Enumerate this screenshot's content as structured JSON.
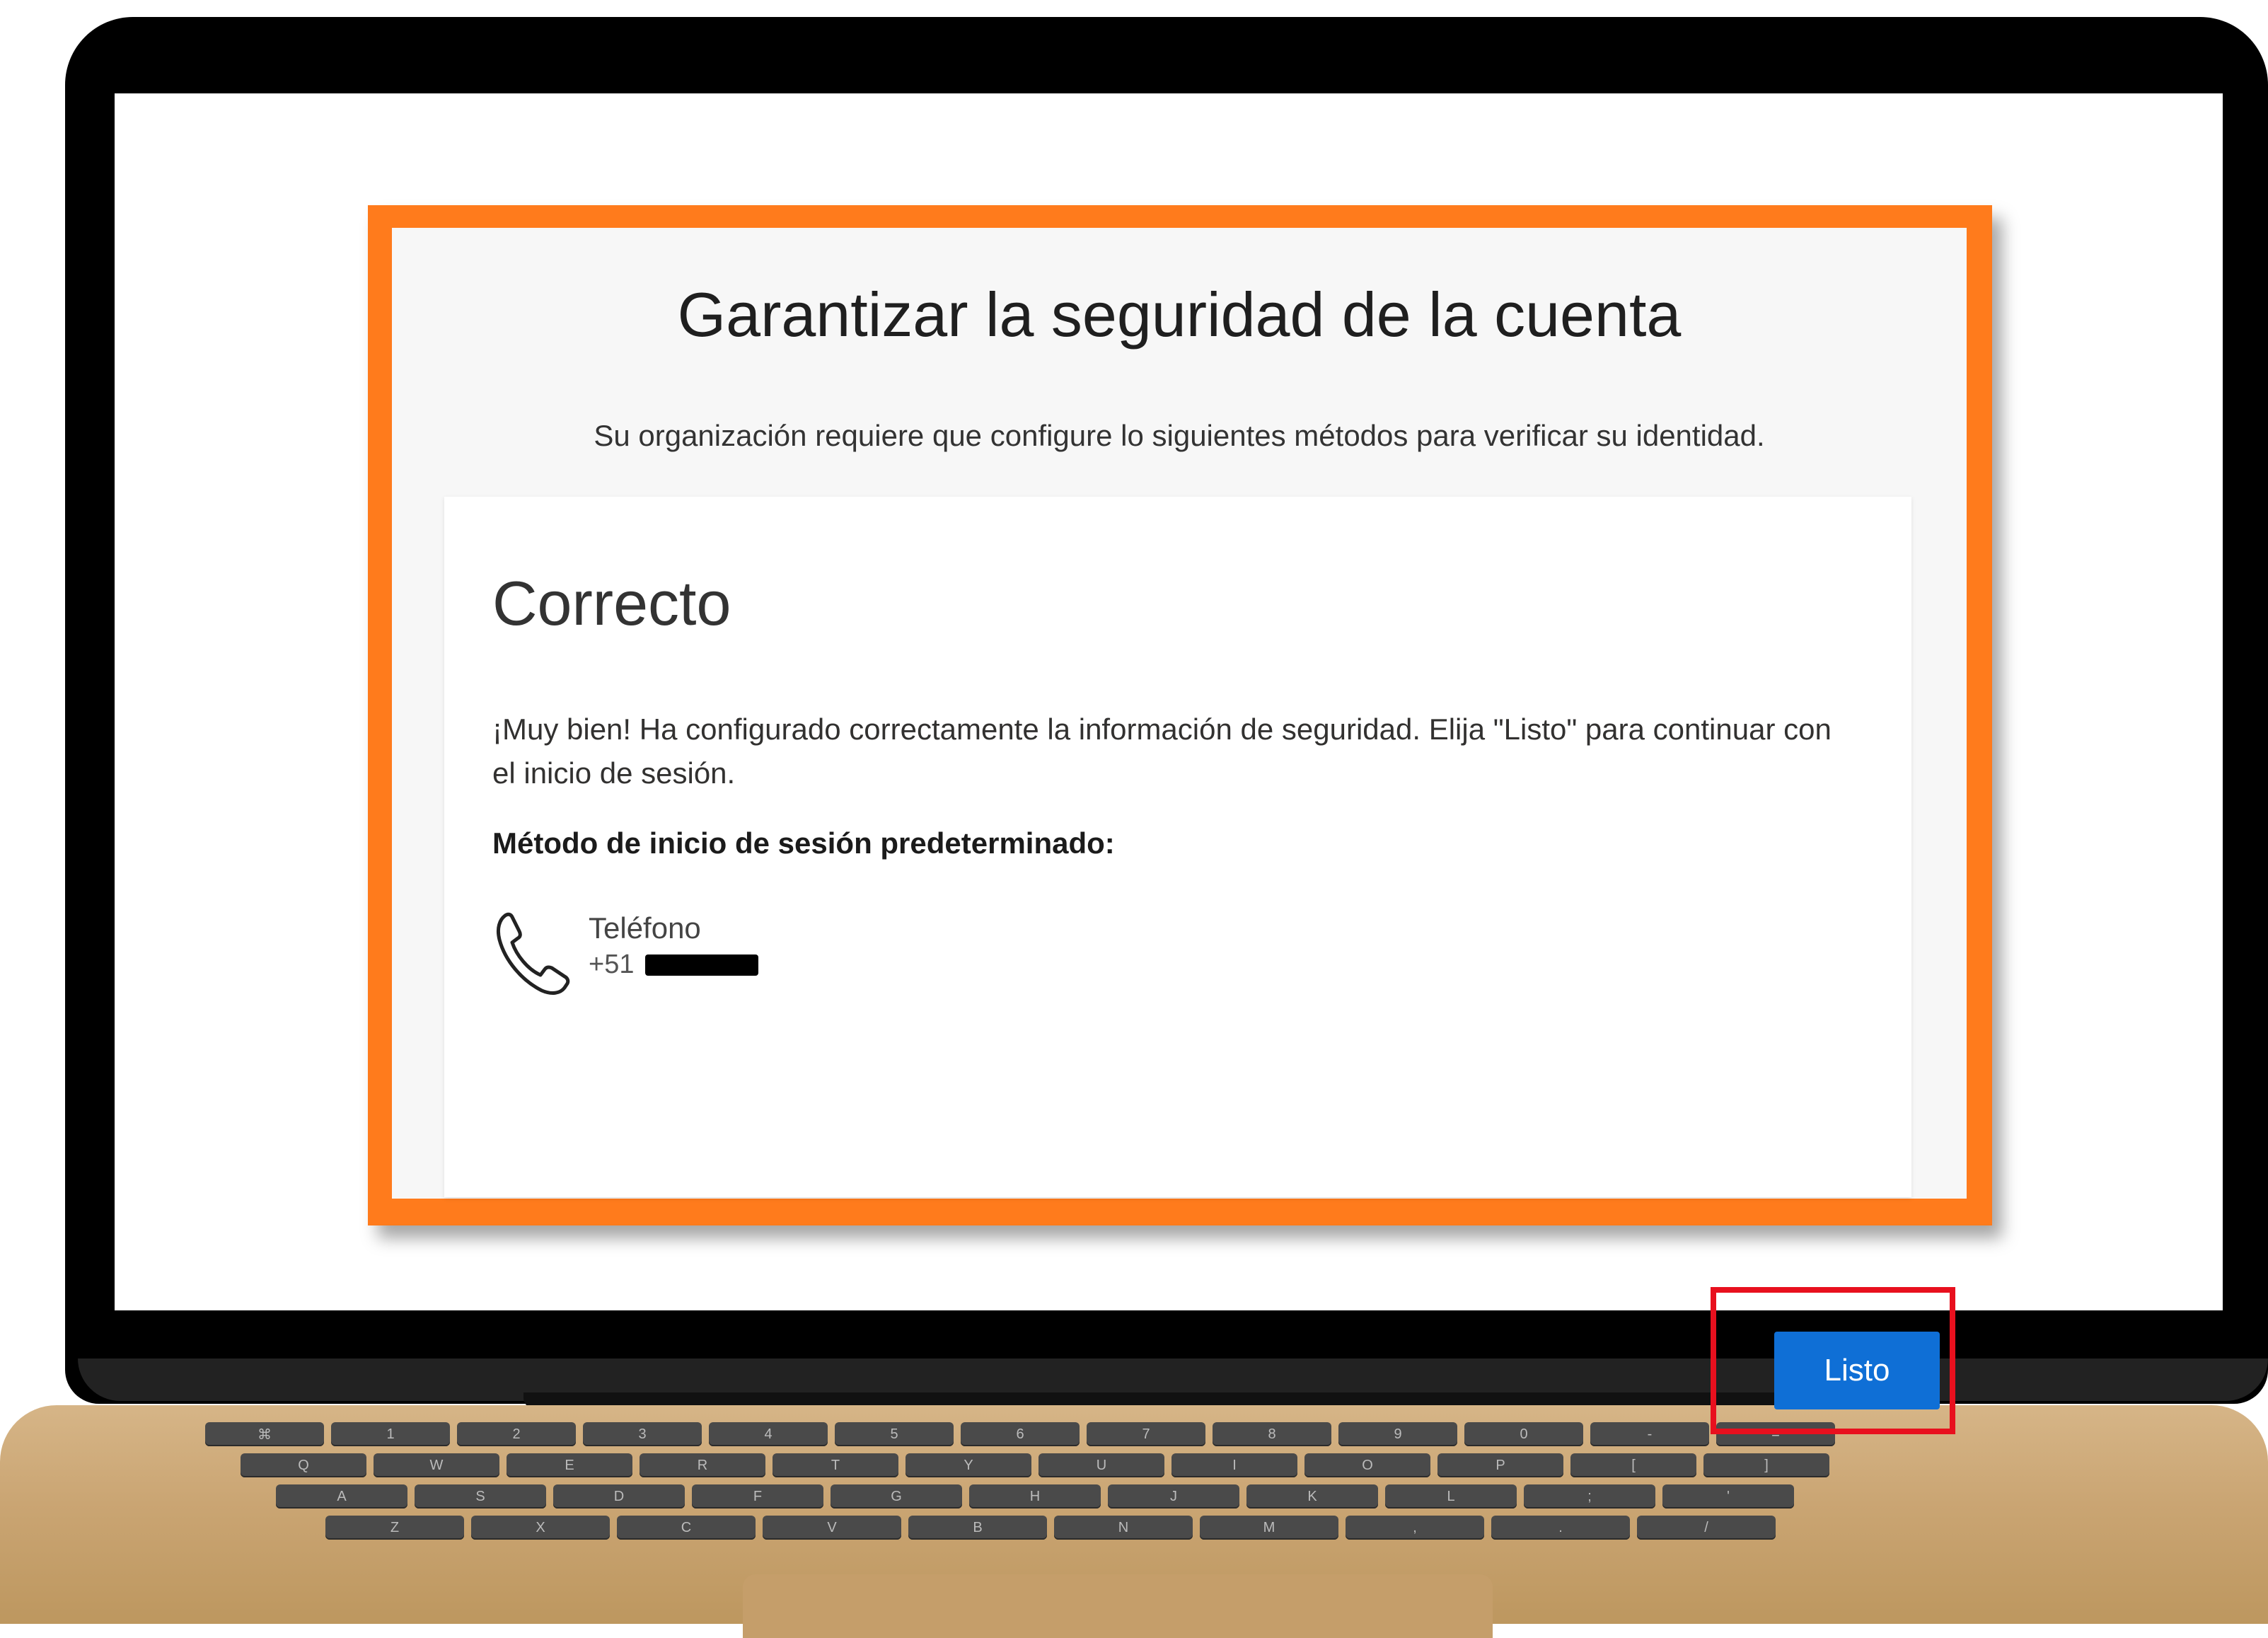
{
  "dialog": {
    "title": "Garantizar la seguridad de la cuenta",
    "subtitle": "Su organización requiere que configure lo siguientes métodos para verificar su identidad."
  },
  "card": {
    "title": "Correcto",
    "message": "¡Muy bien! Ha configurado correctamente la información de seguridad. Elija \"Listo\" para continuar con el inicio de sesión.",
    "method_heading": "Método de inicio de sesión predeterminado:",
    "method": {
      "icon": "phone-icon",
      "name": "Teléfono",
      "value_prefix": "+51"
    },
    "done_label": "Listo"
  },
  "colors": {
    "frame_accent": "#ff7b1c",
    "highlight": "#e8101e",
    "button": "#0f6fd6"
  },
  "keyboard": {
    "row1": [
      "⌘",
      "1",
      "2",
      "3",
      "4",
      "5",
      "6",
      "7",
      "8",
      "9",
      "0",
      "-",
      "="
    ],
    "row2": [
      "Q",
      "W",
      "E",
      "R",
      "T",
      "Y",
      "U",
      "I",
      "O",
      "P",
      "[",
      "]"
    ],
    "row3": [
      "A",
      "S",
      "D",
      "F",
      "G",
      "H",
      "J",
      "K",
      "L",
      ";",
      "'"
    ],
    "row4": [
      "Z",
      "X",
      "C",
      "V",
      "B",
      "N",
      "M",
      ",",
      ".",
      "/"
    ]
  }
}
